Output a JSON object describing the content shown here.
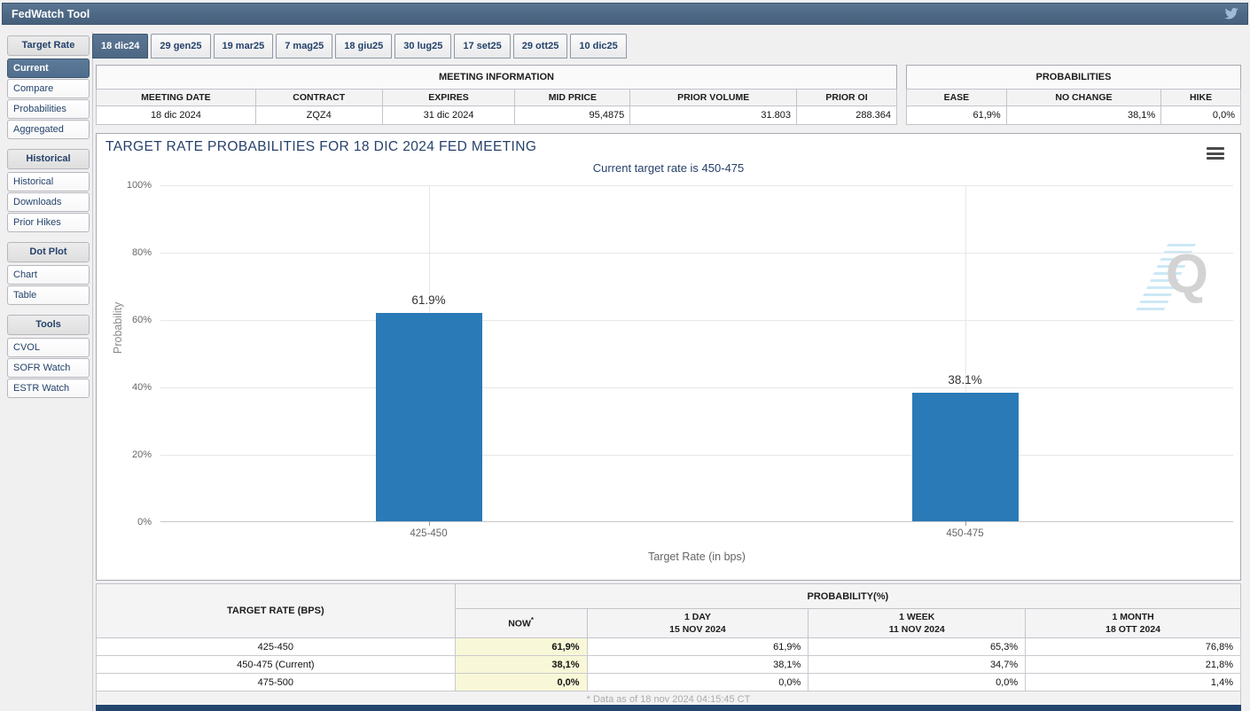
{
  "titlebar": {
    "title": "FedWatch Tool"
  },
  "sidebar": {
    "sections": [
      {
        "header": "Target Rate",
        "items": [
          "Current",
          "Compare",
          "Probabilities",
          "Aggregated"
        ]
      },
      {
        "header": "Historical",
        "items": [
          "Historical",
          "Downloads",
          "Prior Hikes"
        ]
      },
      {
        "header": "Dot Plot",
        "items": [
          "Chart",
          "Table"
        ]
      },
      {
        "header": "Tools",
        "items": [
          "CVOL",
          "SOFR Watch",
          "ESTR Watch"
        ]
      }
    ],
    "selected_item": "Current"
  },
  "tabs": {
    "items": [
      "18 dic24",
      "29 gen25",
      "19 mar25",
      "7 mag25",
      "18 giu25",
      "30 lug25",
      "17 set25",
      "29 ott25",
      "10 dic25"
    ],
    "selected": "18 dic24"
  },
  "meeting_info": {
    "title": "MEETING INFORMATION",
    "columns": [
      "MEETING DATE",
      "CONTRACT",
      "EXPIRES",
      "MID PRICE",
      "PRIOR VOLUME",
      "PRIOR OI"
    ],
    "values": [
      "18 dic 2024",
      "ZQZ4",
      "31 dic 2024",
      "95,4875",
      "31.803",
      "288.364"
    ]
  },
  "probabilities_box": {
    "title": "PROBABILITIES",
    "columns": [
      "EASE",
      "NO CHANGE",
      "HIKE"
    ],
    "values": [
      "61,9%",
      "38,1%",
      "0,0%"
    ]
  },
  "chart_data": {
    "type": "bar",
    "title": "TARGET RATE PROBABILITIES FOR 18 DIC 2024 FED MEETING",
    "subtitle": "Current target rate is 450-475",
    "categories": [
      "425-450",
      "450-475"
    ],
    "values": [
      61.9,
      38.1
    ],
    "bar_labels": [
      "61.9%",
      "38.1%"
    ],
    "xlabel": "Target Rate (in bps)",
    "ylabel": "Probability",
    "ylim": [
      0,
      100
    ],
    "yticks": [
      "0%",
      "20%",
      "40%",
      "60%",
      "80%",
      "100%"
    ],
    "grid": true,
    "legend": "none",
    "bar_color": "#2a7ab7"
  },
  "bottom_table": {
    "rate_header": "TARGET RATE (BPS)",
    "group_header": "PROBABILITY(%)",
    "now_label": "NOW",
    "now_sup": "*",
    "periods": [
      {
        "l1": "1 DAY",
        "l2": "15 NOV 2024"
      },
      {
        "l1": "1 WEEK",
        "l2": "11 NOV 2024"
      },
      {
        "l1": "1 MONTH",
        "l2": "18 OTT 2024"
      }
    ],
    "rows": [
      {
        "rate": "425-450",
        "values": [
          "61,9%",
          "61,9%",
          "65,3%",
          "76,8%"
        ]
      },
      {
        "rate": "450-475 (Current)",
        "values": [
          "38,1%",
          "38,1%",
          "34,7%",
          "21,8%"
        ]
      },
      {
        "rate": "475-500",
        "values": [
          "0,0%",
          "0,0%",
          "0,0%",
          "1,4%"
        ]
      }
    ],
    "footnote": "* Data as of 18 nov 2024 04:15:45 CT"
  },
  "colors": {
    "titlebar": "#4d6884",
    "selected_item": "#4f6d8c",
    "bar": "#2a7ab7",
    "now_highlight": "#f8f8d8",
    "navy_text": "#24426b"
  }
}
